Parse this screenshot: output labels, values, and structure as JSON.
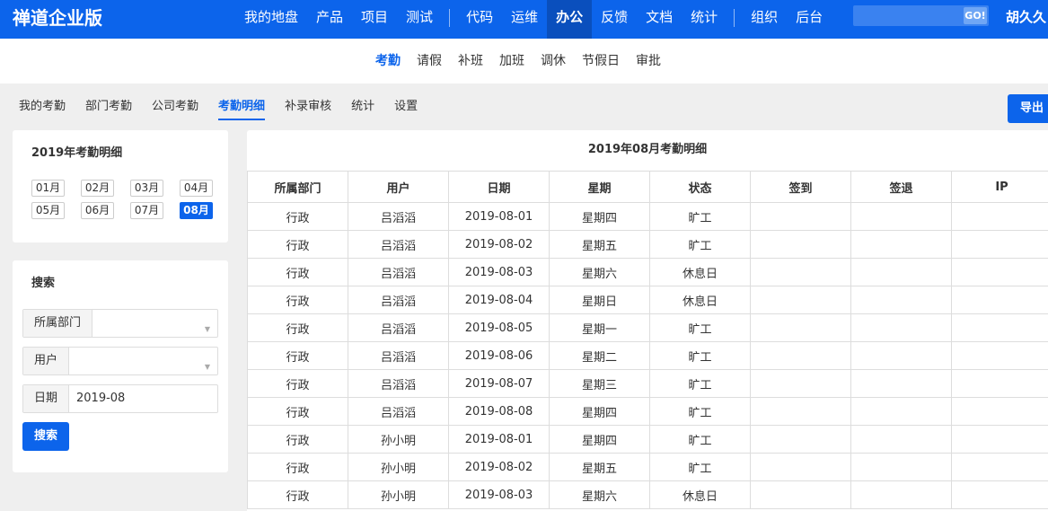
{
  "header": {
    "brand": "禅道企业版",
    "nav_group1": [
      "我的地盘",
      "产品",
      "项目",
      "测试"
    ],
    "nav_group2": [
      "代码",
      "运维",
      "办公",
      "反馈",
      "文档",
      "统计"
    ],
    "nav_group3": [
      "组织",
      "后台"
    ],
    "active_nav": "办公",
    "search_placeholder": "",
    "go_label": "GO!",
    "user": "胡久久"
  },
  "subnav": {
    "items": [
      "考勤",
      "请假",
      "补班",
      "加班",
      "调休",
      "节假日",
      "审批"
    ],
    "active": "考勤"
  },
  "tabs": {
    "items": [
      "我的考勤",
      "部门考勤",
      "公司考勤",
      "考勤明细",
      "补录审核",
      "统计",
      "设置"
    ],
    "active": "考勤明细",
    "export_label": "导出"
  },
  "year_panel": {
    "title": "2019年考勤明细",
    "months": [
      "01月",
      "02月",
      "03月",
      "04月",
      "05月",
      "06月",
      "07月",
      "08月"
    ],
    "active_month": "08月"
  },
  "search_panel": {
    "title": "搜索",
    "dept_label": "所属部门",
    "dept_value": "",
    "user_label": "用户",
    "user_value": "",
    "date_label": "日期",
    "date_value": "2019-08",
    "search_button": "搜索"
  },
  "table": {
    "title": "2019年08月考勤明细",
    "columns": [
      "所属部门",
      "用户",
      "日期",
      "星期",
      "状态",
      "签到",
      "签退",
      "IP"
    ],
    "rows": [
      [
        "行政",
        "吕滔滔",
        "2019-08-01",
        "星期四",
        "旷工",
        "",
        "",
        ""
      ],
      [
        "行政",
        "吕滔滔",
        "2019-08-02",
        "星期五",
        "旷工",
        "",
        "",
        ""
      ],
      [
        "行政",
        "吕滔滔",
        "2019-08-03",
        "星期六",
        "休息日",
        "",
        "",
        ""
      ],
      [
        "行政",
        "吕滔滔",
        "2019-08-04",
        "星期日",
        "休息日",
        "",
        "",
        ""
      ],
      [
        "行政",
        "吕滔滔",
        "2019-08-05",
        "星期一",
        "旷工",
        "",
        "",
        ""
      ],
      [
        "行政",
        "吕滔滔",
        "2019-08-06",
        "星期二",
        "旷工",
        "",
        "",
        ""
      ],
      [
        "行政",
        "吕滔滔",
        "2019-08-07",
        "星期三",
        "旷工",
        "",
        "",
        ""
      ],
      [
        "行政",
        "吕滔滔",
        "2019-08-08",
        "星期四",
        "旷工",
        "",
        "",
        ""
      ],
      [
        "行政",
        "孙小明",
        "2019-08-01",
        "星期四",
        "旷工",
        "",
        "",
        ""
      ],
      [
        "行政",
        "孙小明",
        "2019-08-02",
        "星期五",
        "旷工",
        "",
        "",
        ""
      ],
      [
        "行政",
        "孙小明",
        "2019-08-03",
        "星期六",
        "休息日",
        "",
        "",
        ""
      ]
    ]
  }
}
